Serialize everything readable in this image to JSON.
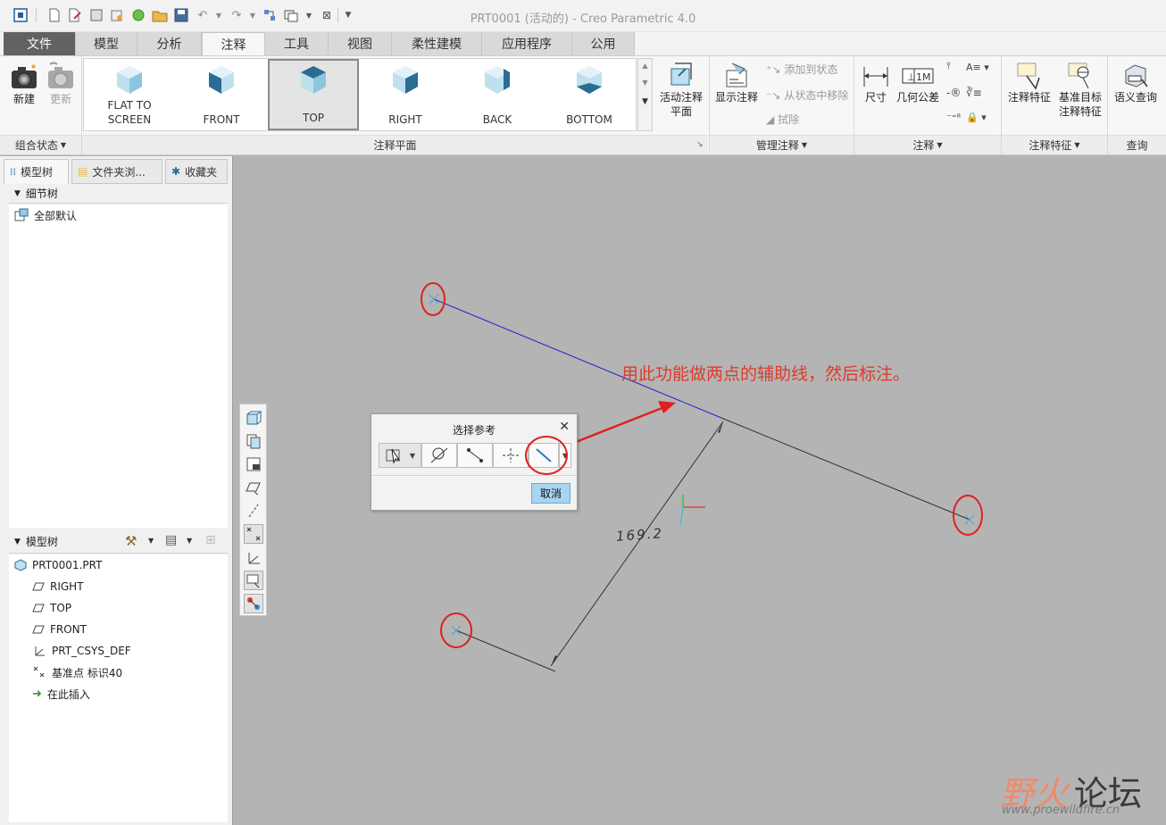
{
  "window": {
    "title": "PRT0001 (活动的) - Creo Parametric 4.0"
  },
  "tabs": [
    {
      "label": "文件"
    },
    {
      "label": "模型"
    },
    {
      "label": "分析"
    },
    {
      "label": "注释"
    },
    {
      "label": "工具"
    },
    {
      "label": "视图"
    },
    {
      "label": "柔性建模"
    },
    {
      "label": "应用程序"
    },
    {
      "label": "公用"
    }
  ],
  "active_tab": "注释",
  "ribbon": {
    "combo_state": {
      "new_label": "新建",
      "update_label": "更新",
      "footer": "组合状态"
    },
    "annotation_planes": {
      "views": [
        {
          "label": "FLAT TO\nSCREEN"
        },
        {
          "label": "FRONT"
        },
        {
          "label": "TOP"
        },
        {
          "label": "RIGHT"
        },
        {
          "label": "BACK"
        },
        {
          "label": "BOTTOM"
        }
      ],
      "selected_view": "TOP",
      "active_plane_label": "活动注释\n平面",
      "footer": "注释平面"
    },
    "manage": {
      "show_label": "显示注释",
      "add_state": "添加到状态",
      "remove_state": "从状态中移除",
      "erase": "拭除",
      "footer": "管理注释"
    },
    "annotation": {
      "dimension": "尺寸",
      "gtol": "几何公差",
      "footer": "注释"
    },
    "feature": {
      "ann_feature": "注释特征",
      "datum_target": "基准目标\n注释特征",
      "footer": "注释特征"
    },
    "query": {
      "semantic": "语义查询",
      "footer": "查询"
    }
  },
  "left_panel": {
    "tabs": [
      {
        "label": "模型树"
      },
      {
        "label": "文件夹浏..."
      },
      {
        "label": "收藏夹"
      }
    ],
    "detail_tree": {
      "header": "细节树",
      "items": [
        {
          "label": "全部默认"
        }
      ]
    },
    "model_tree": {
      "header": "模型树",
      "items": [
        {
          "label": "PRT0001.PRT"
        },
        {
          "label": "RIGHT"
        },
        {
          "label": "TOP"
        },
        {
          "label": "FRONT"
        },
        {
          "label": "PRT_CSYS_DEF"
        },
        {
          "label": "基准点 标识40"
        },
        {
          "label": "在此插入"
        }
      ]
    }
  },
  "dialog": {
    "title": "选择参考",
    "cancel_label": "取消"
  },
  "graphics": {
    "dimension_value": "169.2",
    "annotation_text": "用此功能做两点的辅助线，然后标注。"
  },
  "watermark": {
    "text_a": "野火",
    "text_b": "论坛",
    "url": "www.proewildfire.cn"
  },
  "colors": {
    "annotation_red": "#e03a2a",
    "aux_line_blue": "#2222cc",
    "selected_button": "#a7d4f0"
  }
}
